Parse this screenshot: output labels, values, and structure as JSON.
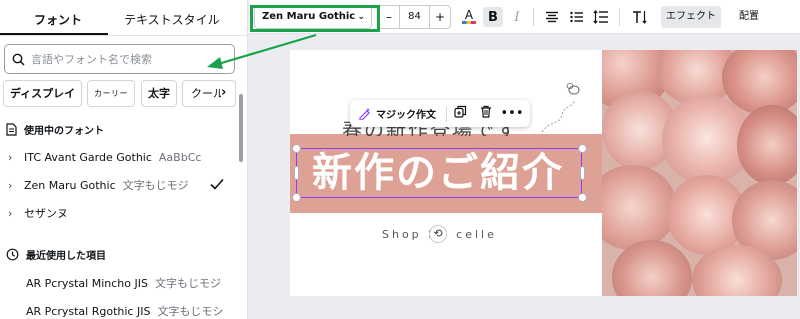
{
  "panel": {
    "tabs": [
      {
        "label": "フォント"
      },
      {
        "label": "テキストスタイル"
      }
    ],
    "search": {
      "placeholder": "言語やフォント名で検索"
    },
    "chips": [
      {
        "label": "ディスプレイ"
      },
      {
        "label": "カーリー"
      },
      {
        "label": "太字"
      },
      {
        "label": "クール"
      }
    ],
    "chip_next_icon": "chevron-right-icon",
    "in_use_section": {
      "title": "使用中のフォント",
      "icon": "document-icon",
      "fonts": [
        {
          "name": "ITC Avant Garde Gothic",
          "sample": "AaBbCc",
          "selected": false
        },
        {
          "name": "Zen Maru Gothic",
          "sample": "文字もじモジ",
          "selected": true
        },
        {
          "name": "セザンヌ",
          "sample": "",
          "selected": false
        }
      ]
    },
    "recent_section": {
      "title": "最近使用した項目",
      "icon": "clock-icon",
      "fonts": [
        {
          "name": "AR Pcrystal Mincho JIS",
          "sample": "文字もじモジ"
        },
        {
          "name": "AR Pcrystal Rgothic JIS",
          "sample": "文字もじモシ"
        }
      ]
    }
  },
  "toolbar": {
    "font_family": "Zen Maru Gothic",
    "font_size": "84",
    "minus": "–",
    "plus": "+",
    "text_color_icon": "A",
    "bold": "B",
    "italic": "I",
    "effects": "エフェクト",
    "position": "配置"
  },
  "canvas": {
    "subtitle": "春の新作登場です",
    "headline": "新作のご紹介",
    "shop_before": "Shop b",
    "shop_after": "celle",
    "context_menu": {
      "magic_write": "マジック作文"
    }
  },
  "colors": {
    "accent_highlight": "#1aa34a",
    "selection": "#8b3dff",
    "band": "#dea195",
    "headline_text": "#ffffff"
  }
}
